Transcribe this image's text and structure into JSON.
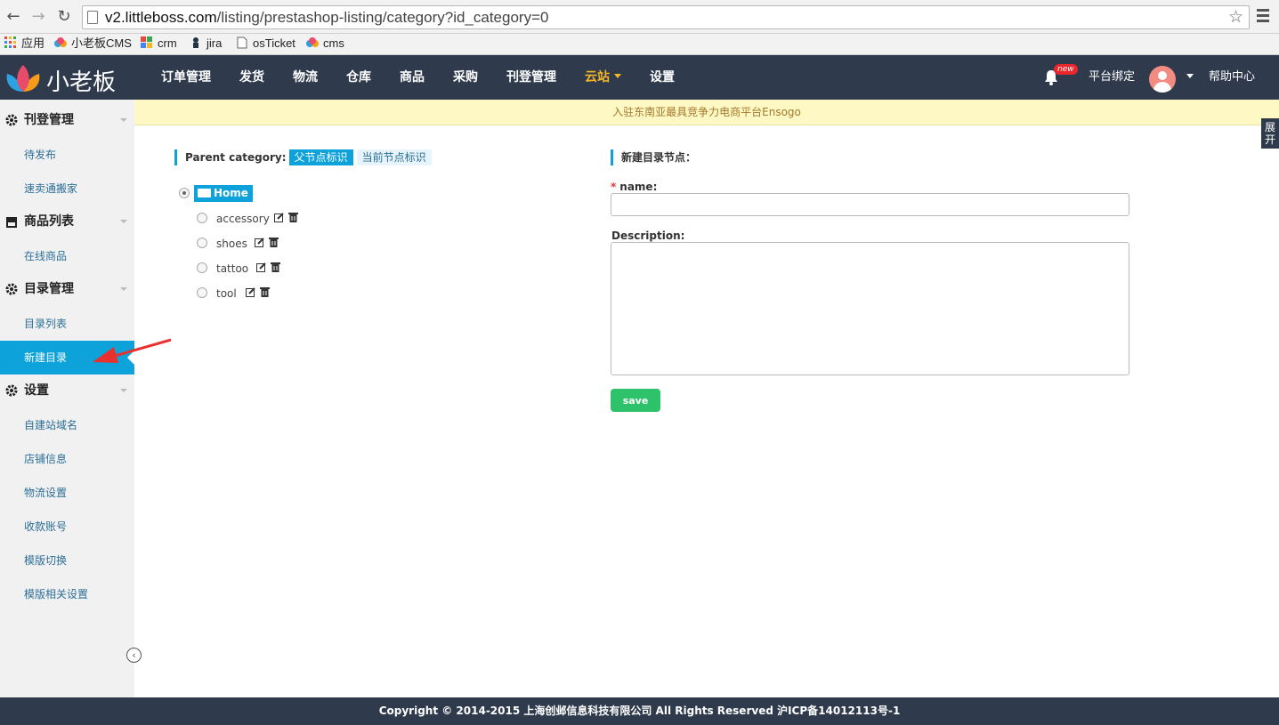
{
  "browser": {
    "url_domain": "v2.littleboss.com",
    "url_path": "/listing/prestashop-listing/category?id_category=0",
    "bookmarks": [
      "应用",
      "小老板CMS",
      "crm",
      "jira",
      "osTicket",
      "cms"
    ]
  },
  "header": {
    "logo_text": "小老板",
    "nav": [
      "订单管理",
      "发货",
      "物流",
      "仓库",
      "商品",
      "采购",
      "刊登管理",
      "云站",
      "设置"
    ],
    "badge": "new",
    "platform_bind": "平台绑定",
    "help": "帮助中心"
  },
  "notice": "入驻东南亚最具竞争力电商平台Ensogo",
  "expand_tab": "展开",
  "sidebar": {
    "sections": [
      {
        "title": "刊登管理",
        "items": [
          "待发布",
          "速卖通搬家"
        ]
      },
      {
        "title": "商品列表",
        "items": [
          "在线商品"
        ]
      },
      {
        "title": "目录管理",
        "items": [
          "目录列表",
          "新建目录"
        ]
      },
      {
        "title": "设置",
        "items": [
          "自建站域名",
          "店铺信息",
          "物流设置",
          "收款账号",
          "模版切换",
          "模版相关设置"
        ]
      }
    ],
    "active_item": "新建目录"
  },
  "tree": {
    "title": "Parent category:",
    "parent_chip": "父节点标识",
    "current_chip": "当前节点标识",
    "root": "Home",
    "children": [
      "accessory",
      "shoes",
      "tattoo",
      "tool"
    ]
  },
  "form": {
    "title": "新建目录节点：",
    "name_label": "name:",
    "name_value": "",
    "desc_label": "Description:",
    "desc_value": "",
    "save": "save"
  },
  "footer": "Copyright © 2014-2015 上海创邺信息科技有限公司 All Rights Reserved 沪ICP备14012113号-1",
  "colors": {
    "header_bg": "#2f3b4c",
    "accent": "#0ea2da",
    "active_nav": "#f5b824",
    "save_green": "#2ec26a",
    "notice_bg": "#fdf8c4"
  }
}
